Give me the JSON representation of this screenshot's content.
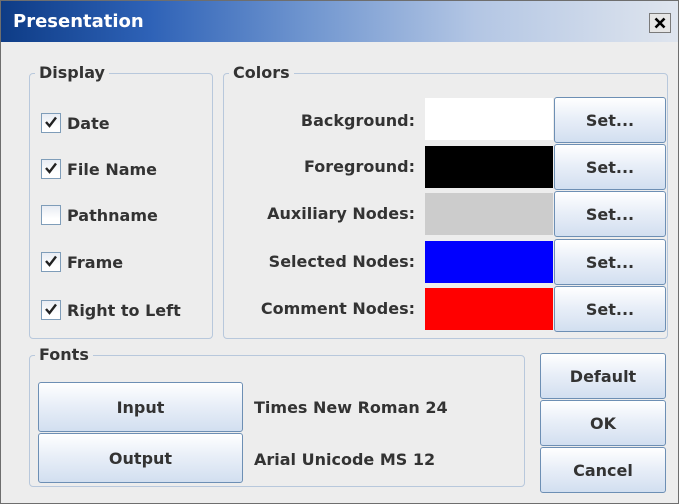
{
  "window": {
    "title": "Presentation"
  },
  "display": {
    "title": "Display",
    "items": [
      {
        "label": "Date",
        "checked": true
      },
      {
        "label": "File Name",
        "checked": true
      },
      {
        "label": "Pathname",
        "checked": false
      },
      {
        "label": "Frame",
        "checked": true
      },
      {
        "label": "Right to Left",
        "checked": true
      }
    ]
  },
  "colors": {
    "title": "Colors",
    "set_label": "Set...",
    "items": [
      {
        "label": "Background:",
        "color": "#ffffff"
      },
      {
        "label": "Foreground:",
        "color": "#000000"
      },
      {
        "label": "Auxiliary Nodes:",
        "color": "#cccccc"
      },
      {
        "label": "Selected Nodes:",
        "color": "#0000ff"
      },
      {
        "label": "Comment Nodes:",
        "color": "#ff0000"
      }
    ]
  },
  "fonts": {
    "title": "Fonts",
    "input_label": "Input",
    "input_font": "Times New Roman  24",
    "output_label": "Output",
    "output_font": "Arial Unicode MS  12"
  },
  "buttons": {
    "default_label": "Default",
    "ok_label": "OK",
    "cancel_label": "Cancel"
  }
}
